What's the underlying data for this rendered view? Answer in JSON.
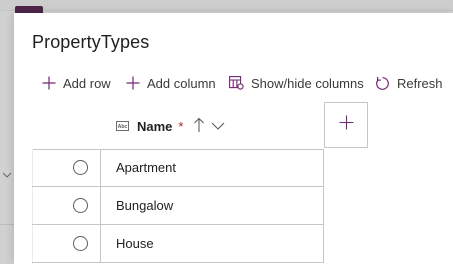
{
  "panel": {
    "title": "PropertyTypes"
  },
  "toolbar": {
    "add_row": {
      "label": "Add row",
      "icon": "plus-icon"
    },
    "add_column": {
      "label": "Add column",
      "icon": "plus-icon"
    },
    "show_hide_columns": {
      "label": "Show/hide columns",
      "icon": "columns-icon"
    },
    "refresh": {
      "label": "Refresh",
      "icon": "refresh-icon"
    }
  },
  "table": {
    "column": {
      "label": "Name",
      "required_marker": "*",
      "type_icon": "text-field-icon",
      "sort": "ascending",
      "sort_icon": "arrow-up-icon",
      "menu_icon": "chevron-down-icon"
    },
    "add_column_icon": "plus-icon",
    "rows": [
      {
        "name": "Apartment"
      },
      {
        "name": "Bungalow"
      },
      {
        "name": "House"
      }
    ]
  },
  "colors": {
    "accent": "#742774",
    "required": "#a4262c",
    "text": "#201f1e",
    "border": "#c8c6c4"
  }
}
